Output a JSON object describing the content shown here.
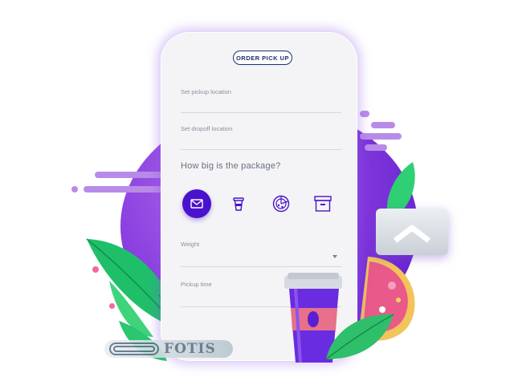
{
  "header": {
    "title": "ORDER PICK UP"
  },
  "form": {
    "pickup_label": "Set pickup location",
    "dropoff_label": "Set dropoff location",
    "package_question": "How big is the package?",
    "sizes": [
      {
        "icon": "envelope-icon",
        "selected": true
      },
      {
        "icon": "coffee-cup-icon",
        "selected": false
      },
      {
        "icon": "pizza-icon",
        "selected": false
      },
      {
        "icon": "box-icon",
        "selected": false
      }
    ],
    "weight_label": "Weight",
    "pickup_time_label": "Pickup time"
  },
  "watermark": {
    "text": "FOTIS"
  },
  "colors": {
    "accent": "#4a12cc",
    "circle": "#8a3fe0",
    "leaf": "#3fd47a",
    "cup_purple": "#6a2ce0",
    "cup_band": "#e8708a",
    "text_navy": "#1e2f6b"
  }
}
